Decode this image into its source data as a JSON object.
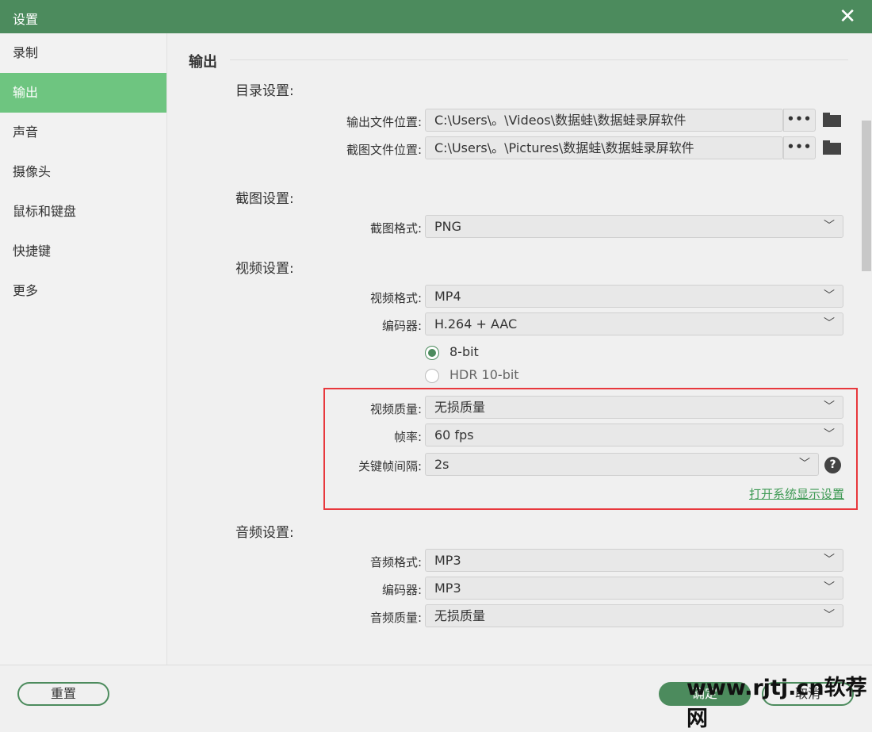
{
  "title": "设置",
  "sidebar": {
    "items": [
      {
        "label": "录制"
      },
      {
        "label": "输出"
      },
      {
        "label": "声音"
      },
      {
        "label": "摄像头"
      },
      {
        "label": "鼠标和键盘"
      },
      {
        "label": "快捷键"
      },
      {
        "label": "更多"
      }
    ]
  },
  "main": {
    "section": "输出",
    "dir": {
      "heading": "目录设置:",
      "video_label": "输出文件位置:",
      "video_path": "C:\\Users\\。\\Videos\\数据蛙\\数据蛙录屏软件",
      "shot_label": "截图文件位置:",
      "shot_path": "C:\\Users\\。\\Pictures\\数据蛙\\数据蛙录屏软件",
      "browse": "•••"
    },
    "screenshot": {
      "heading": "截图设置:",
      "format_label": "截图格式:",
      "format": "PNG"
    },
    "video": {
      "heading": "视频设置:",
      "format_label": "视频格式:",
      "format": "MP4",
      "codec_label": "编码器:",
      "codec": "H.264 + AAC",
      "bit8": "8-bit",
      "hdr": "HDR 10-bit",
      "quality_label": "视频质量:",
      "quality": "无损质量",
      "fps_label": "帧率:",
      "fps": "60 fps",
      "keyframe_label": "关键帧间隔:",
      "keyframe": "2s",
      "help": "?",
      "link": "打开系统显示设置"
    },
    "audio": {
      "heading": "音频设置:",
      "format_label": "音频格式:",
      "format": "MP3",
      "codec_label": "编码器:",
      "codec": "MP3",
      "quality_label": "音频质量:",
      "quality": "无损质量"
    }
  },
  "footer": {
    "reset": "重置",
    "ok": "确定",
    "cancel": "取消"
  },
  "watermark": "www.rjtj.cn软荐网"
}
